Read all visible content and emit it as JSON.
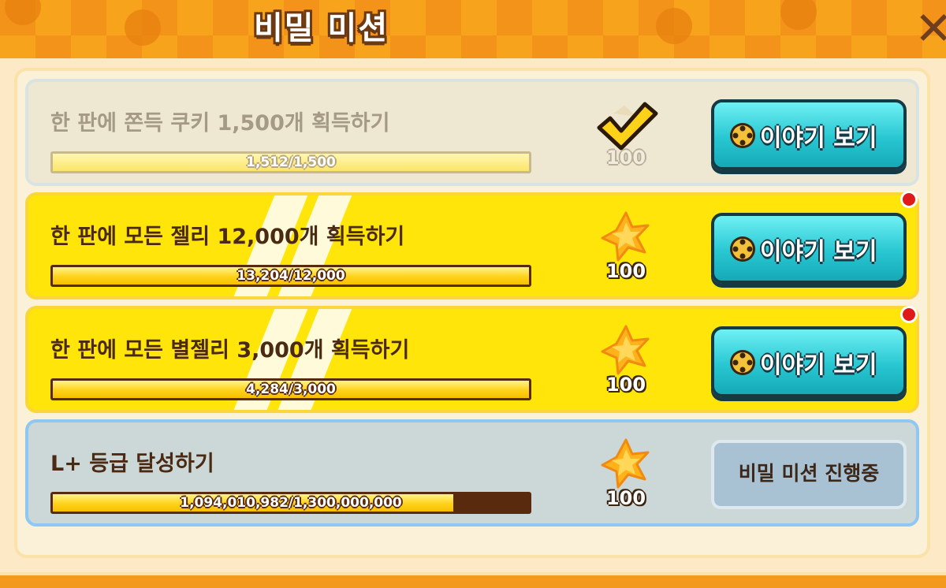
{
  "header": {
    "title": "비밀 미션"
  },
  "missions": [
    {
      "text": "한 판에 쫀득 쿠키 1,500개 획득하기",
      "progress_text": "1,512/1,500",
      "progress": 1.0,
      "reward": "100",
      "state": "completed",
      "button_label": "이야기 보기"
    },
    {
      "text": "한 판에 모든 젤리 12,000개 획득하기",
      "progress_text": "13,204/12,000",
      "progress": 1.0,
      "reward": "100",
      "state": "claimable",
      "button_label": "이야기 보기"
    },
    {
      "text": "한 판에 모든 별젤리 3,000개 획득하기",
      "progress_text": "4,284/3,000",
      "progress": 1.0,
      "reward": "100",
      "state": "claimable",
      "button_label": "이야기 보기"
    },
    {
      "text": "L+ 등급 달성하기",
      "progress_text": "1,094,010,982/1,300,000,000",
      "progress": 0.8415,
      "reward": "100",
      "state": "in-progress",
      "button_label": "비밀 미션 진행중"
    }
  ],
  "colors": {
    "header": "#f7a31c",
    "active_row": "#ffe50a",
    "button": "#28c7d2",
    "notification": "#e01919"
  },
  "icons": [
    "close-icon",
    "check-icon",
    "star-jelly-icon",
    "film-reel-icon"
  ]
}
